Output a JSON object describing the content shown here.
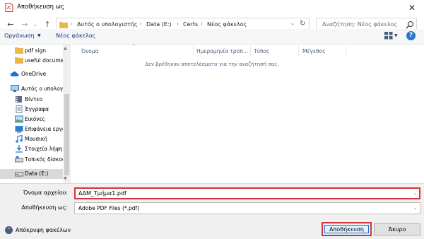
{
  "window": {
    "title": "Αποθήκευση ως",
    "close_glyph": "✕"
  },
  "nav": {
    "back_glyph": "←",
    "forward_glyph": "→",
    "recent_glyph": "⌄",
    "up_glyph": "↑",
    "breadcrumb": [
      "Αυτός ο υπολογιστής",
      "Data (E:)",
      "Certs",
      "Νέος φάκελος"
    ],
    "separator": "›",
    "dropdown_glyph": "⌄",
    "refresh_glyph": "↻",
    "search_placeholder": "Αναζήτηση: Νέος φάκελος"
  },
  "toolbar": {
    "organize_label": "Οργάνωση",
    "organize_caret": "▼",
    "new_folder_label": "Νέος φάκελος",
    "view_caret": "▼",
    "help_glyph": "?"
  },
  "sidebar": {
    "items": [
      {
        "label": "pdf sign",
        "icon": "folder-icon"
      },
      {
        "label": "useful documen",
        "icon": "folder-icon"
      },
      {
        "label": "OneDrive",
        "icon": "onedrive-icon"
      },
      {
        "label": "Αυτός ο υπολογι",
        "icon": "computer-icon"
      },
      {
        "label": "Βίντεο",
        "icon": "videos-icon"
      },
      {
        "label": "Έγγραφα",
        "icon": "documents-icon"
      },
      {
        "label": "Εικόνες",
        "icon": "pictures-icon"
      },
      {
        "label": "Επιφάνεια εργα",
        "icon": "desktop-icon"
      },
      {
        "label": "Μουσική",
        "icon": "music-icon"
      },
      {
        "label": "Στοιχεία λήψης",
        "icon": "downloads-icon"
      },
      {
        "label": "Τοπικός δίσκος",
        "icon": "drive-icon"
      },
      {
        "label": "Data (E:)",
        "icon": "drive-icon",
        "selected": true
      }
    ],
    "scroll_up_glyph": "▲",
    "scroll_down_glyph": "▼"
  },
  "content": {
    "columns": [
      "Όνομα",
      "Ημερομηνία τροπ...",
      "Τύπος",
      "Μέγεθος"
    ],
    "sort_glyph": "^",
    "empty_message": "Δεν βρέθηκαν αποτελέσματα για την αναζήτησή σας."
  },
  "form": {
    "filename_label": "Όνομα αρχείου:",
    "filename_value": "ΔΔΜ_Τμήμα1.pdf",
    "savetype_label": "Αποθήκευση ως:",
    "savetype_value": "Adobe PDF Files (*.pdf)",
    "caret_glyph": "⌄",
    "hide_folders_glyph": "⌃",
    "hide_folders_label": "Απόκρυψη φακέλων",
    "save_label": "Αποθήκευση",
    "cancel_label": "Άκυρο"
  },
  "colors": {
    "highlight_border": "#d8323a",
    "link_blue": "#1e3287",
    "folder_yellow": "#e8b84a"
  }
}
